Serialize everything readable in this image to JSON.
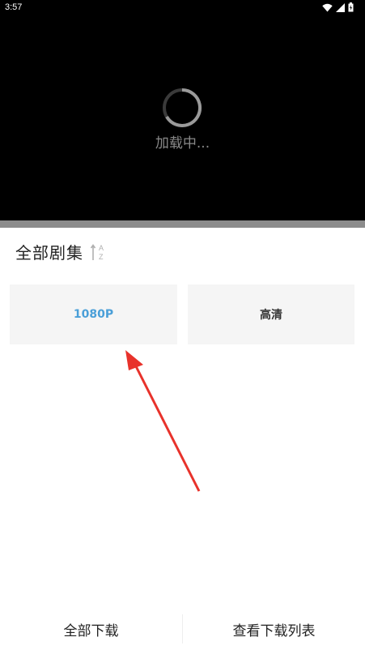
{
  "status_bar": {
    "time": "3:57"
  },
  "player": {
    "loading_text": "加载中..."
  },
  "episodes": {
    "title": "全部剧集",
    "sort_icon": "sort-az-icon",
    "sort_letters": {
      "top": "A",
      "bottom": "Z"
    }
  },
  "qualities": [
    {
      "label": "1080P",
      "selected": true,
      "color": "#4a9fd8"
    },
    {
      "label": "高清",
      "selected": false,
      "color": "#333333"
    }
  ],
  "annotation": {
    "arrow_color": "#e8322b"
  },
  "bottom": {
    "download_all": "全部下载",
    "view_list": "查看下载列表"
  }
}
